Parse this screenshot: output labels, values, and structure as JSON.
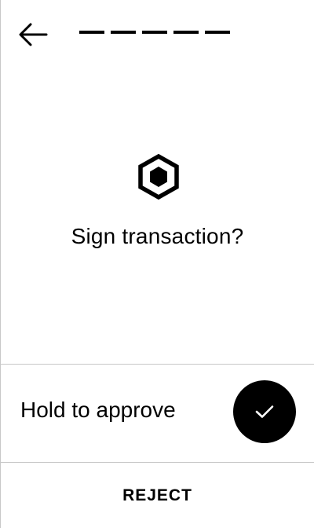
{
  "header": {
    "back_icon": "arrow-left-icon",
    "progress_segments": 5
  },
  "main": {
    "icon": "hexagon-icon",
    "title": "Sign transaction?"
  },
  "approve": {
    "label": "Hold to approve",
    "icon": "checkmark-icon"
  },
  "reject": {
    "label": "REJECT"
  },
  "colors": {
    "background": "#ffffff",
    "foreground": "#000000",
    "divider": "#c8c8c8"
  }
}
